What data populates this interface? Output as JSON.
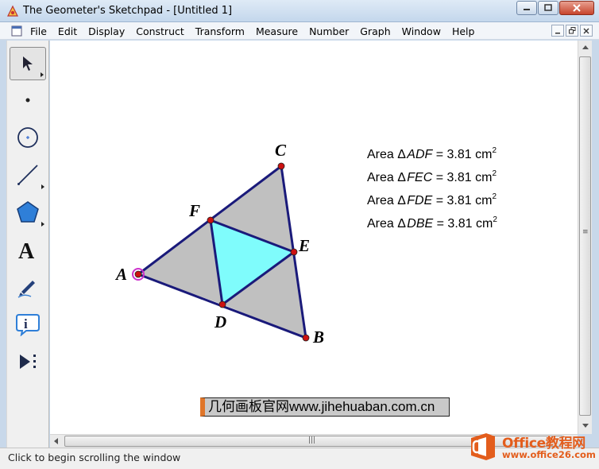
{
  "window": {
    "title": "The Geometer's Sketchpad - [Untitled 1]"
  },
  "menu": {
    "items": [
      "File",
      "Edit",
      "Display",
      "Construct",
      "Transform",
      "Measure",
      "Number",
      "Graph",
      "Window",
      "Help"
    ]
  },
  "toolbox": {
    "tools": [
      "arrow-tool-icon",
      "point-tool-icon",
      "compass-tool-icon",
      "straightedge-tool-icon",
      "polygon-tool-icon",
      "text-tool-icon",
      "marker-tool-icon",
      "information-tool-icon",
      "custom-tool-icon"
    ]
  },
  "canvas": {
    "points": {
      "A": "A",
      "B": "B",
      "C": "C",
      "D": "D",
      "E": "E",
      "F": "F"
    },
    "measurements": [
      {
        "prefix": "Area ",
        "triangle_symbol": "Δ",
        "triangle": "ADF",
        "equals": " = 3.81 cm",
        "exponent": "2"
      },
      {
        "prefix": "Area ",
        "triangle_symbol": "Δ",
        "triangle": "FEC",
        "equals": " = 3.81 cm",
        "exponent": "2"
      },
      {
        "prefix": "Area ",
        "triangle_symbol": "Δ",
        "triangle": "FDE",
        "equals": " = 3.81 cm",
        "exponent": "2"
      },
      {
        "prefix": "Area ",
        "triangle_symbol": "Δ",
        "triangle": "DBE",
        "equals": " = 3.81 cm",
        "exponent": "2"
      }
    ],
    "watermark": "几何画板官网www.jihehuaban.com.cn",
    "colors": {
      "outer_fill": "#c0c0c0",
      "inner_fill": "#7ffcfc",
      "segment": "#1a1a7a",
      "point": "#cc1111",
      "selected_point": "#cc33cc"
    }
  },
  "statusbar": {
    "text": "Click to begin scrolling the window"
  },
  "overlay": {
    "brand": "Office教程网",
    "url": "www.office26.com"
  }
}
